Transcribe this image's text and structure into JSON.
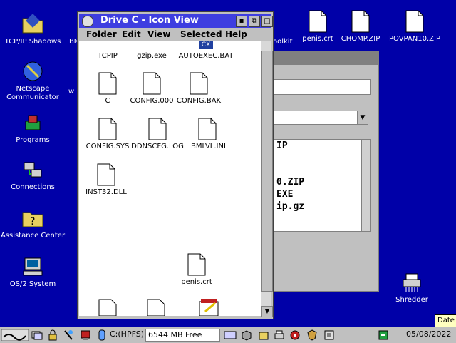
{
  "desktop": {
    "icons": [
      {
        "label": "TCP/IP Shadows"
      },
      {
        "label": "Netscape Communicator"
      },
      {
        "label": "Programs"
      },
      {
        "label": "Connections"
      },
      {
        "label": "Assistance Center"
      },
      {
        "label": "OS/2 System"
      },
      {
        "label": "penis.crt"
      },
      {
        "label": "CHOMP.ZIP"
      },
      {
        "label": "POVPAN10.ZIP"
      },
      {
        "label": "Shredder"
      }
    ],
    "partial_left": "IBN",
    "partial_mid": "oolkit",
    "partial_w": "w"
  },
  "bg_dialog": {
    "list_lines": [
      "IP",
      "",
      "",
      "0.ZIP",
      "EXE",
      "ip.gz"
    ]
  },
  "window": {
    "title": "Drive C - Icon View",
    "menu": [
      "Folder",
      "Edit",
      "View",
      "Selected",
      "Help"
    ],
    "files": [
      {
        "label": "TCPIP"
      },
      {
        "label": "gzip.exe"
      },
      {
        "label": "AUTOEXEC.BAT"
      },
      {
        "label": "C"
      },
      {
        "label": "CONFIG.000"
      },
      {
        "label": "CONFIG.BAK"
      },
      {
        "label": "CONFIG.SYS"
      },
      {
        "label": "DDNSCFG.LOG"
      },
      {
        "label": "IBMLVL.INI"
      },
      {
        "label": "INST32.DLL"
      },
      {
        "label": "penis.crt"
      }
    ],
    "icon_text_cx": "CX"
  },
  "taskbar": {
    "drive": "C:(HPFS)",
    "free": "6544 MB Free",
    "date": "05/08/2022",
    "date_tip": "Date"
  },
  "colors": {
    "desktop": "#0000a8",
    "titlebar": "#3e3ee0",
    "chrome": "#c0c0c0"
  }
}
